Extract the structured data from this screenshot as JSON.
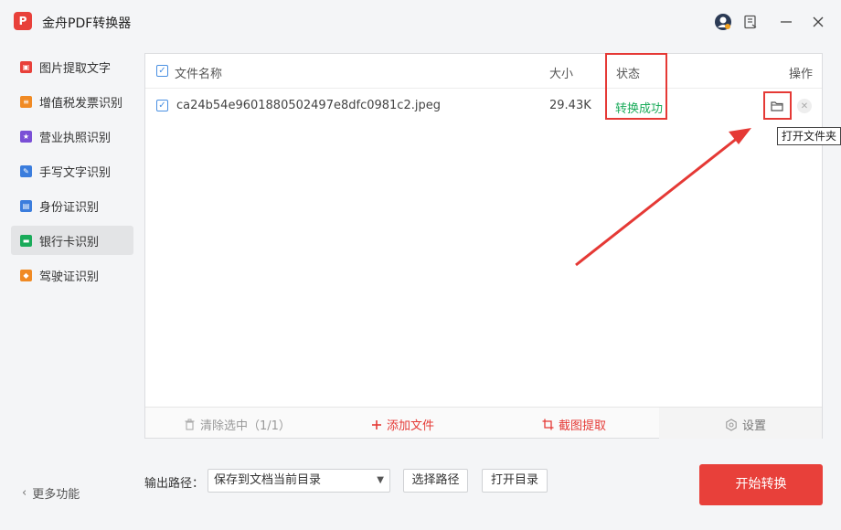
{
  "app": {
    "logo_text": "P",
    "title": "金舟PDF转换器"
  },
  "window_controls": [
    "user-avatar-icon",
    "feedback-icon",
    "minimize-icon",
    "close-icon"
  ],
  "sidebar": {
    "items": [
      {
        "label": "图片提取文字",
        "icon": "image-text-icon",
        "color": "#e8403a"
      },
      {
        "label": "增值税发票识别",
        "icon": "invoice-icon",
        "color": "#f08a24"
      },
      {
        "label": "营业执照识别",
        "icon": "license-icon",
        "color": "#7a4fd6"
      },
      {
        "label": "手写文字识别",
        "icon": "handwriting-icon",
        "color": "#3b7ddd"
      },
      {
        "label": "身份证识别",
        "icon": "id-card-icon",
        "color": "#3b7ddd"
      },
      {
        "label": "银行卡识别",
        "icon": "bank-card-icon",
        "color": "#1aab5a",
        "active": true
      },
      {
        "label": "驾驶证识别",
        "icon": "driver-license-icon",
        "color": "#f08a24"
      }
    ],
    "more_label": "更多功能"
  },
  "table": {
    "headers": {
      "name": "文件名称",
      "size": "大小",
      "status": "状态",
      "action": "操作"
    },
    "rows": [
      {
        "checked": true,
        "name": "ca24b54e9601880502497e8dfc0981c2.jpeg",
        "size": "29.43K",
        "status": "转换成功"
      }
    ],
    "tooltip": "打开文件夹"
  },
  "toolbar": {
    "clear_label": "清除选中（1/1）",
    "add_label": "添加文件",
    "crop_label": "截图提取",
    "settings_label": "设置"
  },
  "output": {
    "label": "输出路径：",
    "selected": "保存到文档当前目录",
    "choose_path": "选择路径",
    "open_dir": "打开目录"
  },
  "start_button": "开始转换",
  "colors": {
    "accent": "#e8403a",
    "success": "#1aab5a",
    "highlight": "#e53935",
    "checkbox": "#4a90e2"
  }
}
